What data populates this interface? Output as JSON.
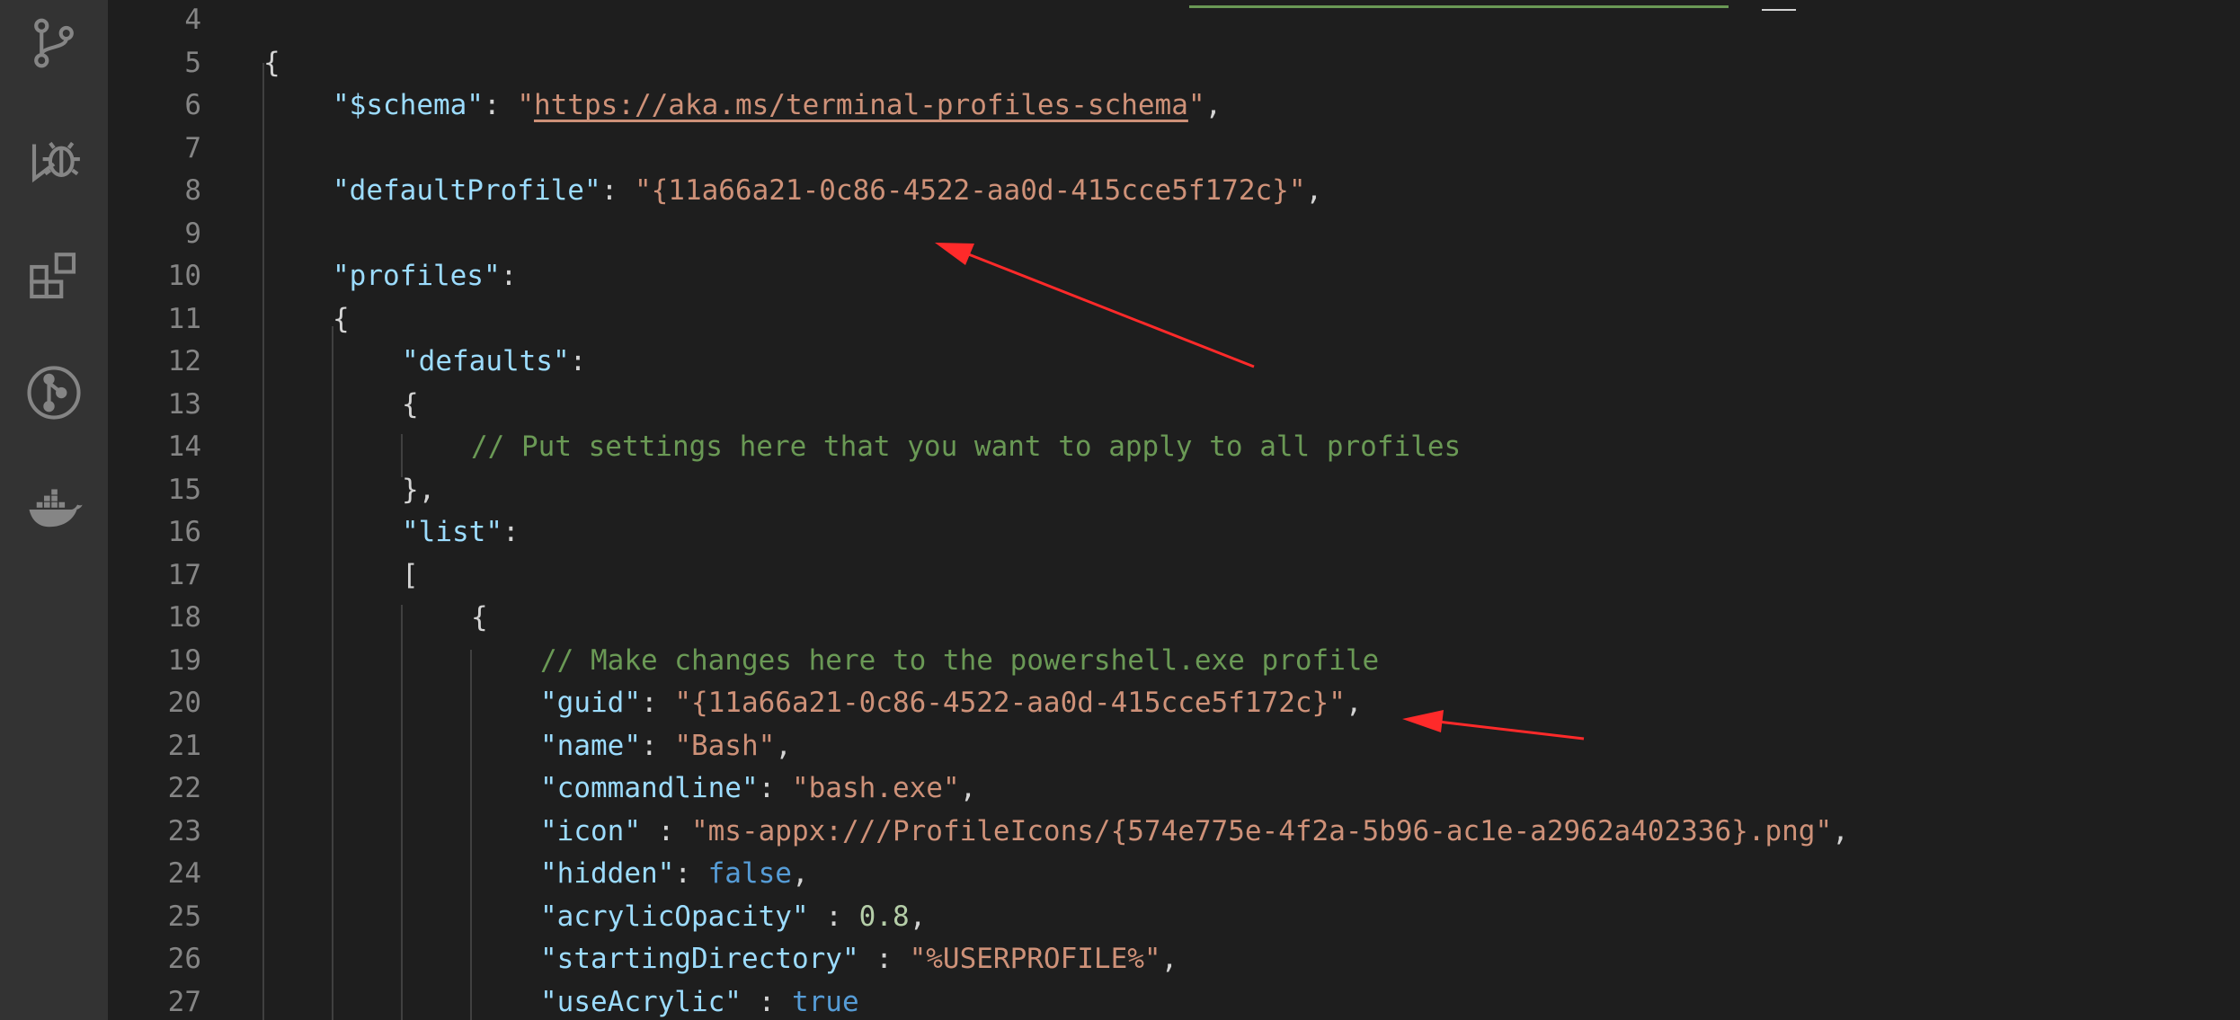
{
  "activity_bar": {
    "icons": [
      "source-control-icon",
      "run-debug-icon",
      "extensions-icon",
      "git-graph-icon",
      "docker-icon"
    ]
  },
  "editor": {
    "lines": [
      {
        "num": "4",
        "tokens": []
      },
      {
        "num": "5",
        "tokens": [
          {
            "t": "{",
            "c": "punc"
          }
        ]
      },
      {
        "num": "6",
        "tokens": [
          {
            "t": "\"$schema\"",
            "c": "key"
          },
          {
            "t": ": ",
            "c": "punc"
          },
          {
            "t": "\"",
            "c": "str"
          },
          {
            "t": "https://aka.ms/terminal-profiles-schema",
            "c": "link"
          },
          {
            "t": "\"",
            "c": "str"
          },
          {
            "t": ",",
            "c": "punc"
          }
        ]
      },
      {
        "num": "7",
        "tokens": []
      },
      {
        "num": "8",
        "tokens": [
          {
            "t": "\"defaultProfile\"",
            "c": "key"
          },
          {
            "t": ": ",
            "c": "punc"
          },
          {
            "t": "\"{11a66a21-0c86-4522-aa0d-415cce5f172c}\"",
            "c": "str"
          },
          {
            "t": ",",
            "c": "punc"
          }
        ]
      },
      {
        "num": "9",
        "tokens": []
      },
      {
        "num": "10",
        "tokens": [
          {
            "t": "\"profiles\"",
            "c": "key"
          },
          {
            "t": ":",
            "c": "punc"
          }
        ]
      },
      {
        "num": "11",
        "tokens": [
          {
            "t": "{",
            "c": "punc"
          }
        ]
      },
      {
        "num": "12",
        "tokens": [
          {
            "t": "\"defaults\"",
            "c": "key"
          },
          {
            "t": ":",
            "c": "punc"
          }
        ]
      },
      {
        "num": "13",
        "tokens": [
          {
            "t": "{",
            "c": "punc"
          }
        ]
      },
      {
        "num": "14",
        "tokens": [
          {
            "t": "// Put settings here that you want to apply to all profiles",
            "c": "com"
          }
        ]
      },
      {
        "num": "15",
        "tokens": [
          {
            "t": "},",
            "c": "punc"
          }
        ]
      },
      {
        "num": "16",
        "tokens": [
          {
            "t": "\"list\"",
            "c": "key"
          },
          {
            "t": ":",
            "c": "punc"
          }
        ]
      },
      {
        "num": "17",
        "tokens": [
          {
            "t": "[",
            "c": "punc"
          }
        ]
      },
      {
        "num": "18",
        "tokens": [
          {
            "t": "{",
            "c": "punc"
          }
        ]
      },
      {
        "num": "19",
        "tokens": [
          {
            "t": "// Make changes here to the powershell.exe profile",
            "c": "com"
          }
        ]
      },
      {
        "num": "20",
        "tokens": [
          {
            "t": "\"guid\"",
            "c": "key"
          },
          {
            "t": ": ",
            "c": "punc"
          },
          {
            "t": "\"{11a66a21-0c86-4522-aa0d-415cce5f172c}\"",
            "c": "str"
          },
          {
            "t": ",",
            "c": "punc"
          }
        ]
      },
      {
        "num": "21",
        "tokens": [
          {
            "t": "\"name\"",
            "c": "key"
          },
          {
            "t": ": ",
            "c": "punc"
          },
          {
            "t": "\"Bash\"",
            "c": "str"
          },
          {
            "t": ",",
            "c": "punc"
          }
        ]
      },
      {
        "num": "22",
        "tokens": [
          {
            "t": "\"commandline\"",
            "c": "key"
          },
          {
            "t": ": ",
            "c": "punc"
          },
          {
            "t": "\"bash.exe\"",
            "c": "str"
          },
          {
            "t": ",",
            "c": "punc"
          }
        ]
      },
      {
        "num": "23",
        "tokens": [
          {
            "t": "\"icon\"",
            "c": "key"
          },
          {
            "t": " : ",
            "c": "punc"
          },
          {
            "t": "\"ms-appx:///ProfileIcons/{574e775e-4f2a-5b96-ac1e-a2962a402336}.png\"",
            "c": "str"
          },
          {
            "t": ",",
            "c": "punc"
          }
        ]
      },
      {
        "num": "24",
        "tokens": [
          {
            "t": "\"hidden\"",
            "c": "key"
          },
          {
            "t": ": ",
            "c": "punc"
          },
          {
            "t": "false",
            "c": "bool"
          },
          {
            "t": ",",
            "c": "punc"
          }
        ]
      },
      {
        "num": "25",
        "tokens": [
          {
            "t": "\"acrylicOpacity\"",
            "c": "key"
          },
          {
            "t": " : ",
            "c": "punc"
          },
          {
            "t": "0.8",
            "c": "num"
          },
          {
            "t": ",",
            "c": "punc"
          }
        ]
      },
      {
        "num": "26",
        "tokens": [
          {
            "t": "\"startingDirectory\"",
            "c": "key"
          },
          {
            "t": " : ",
            "c": "punc"
          },
          {
            "t": "\"%USERPROFILE%\"",
            "c": "str"
          },
          {
            "t": ",",
            "c": "punc"
          }
        ]
      },
      {
        "num": "27",
        "tokens": [
          {
            "t": "\"useAcrylic\"",
            "c": "key"
          },
          {
            "t": " : ",
            "c": "punc"
          },
          {
            "t": "true",
            "c": "bool"
          }
        ]
      }
    ]
  },
  "colors": {
    "editor_bg": "#1e1e1e",
    "activity_bar_bg": "#333333",
    "key": "#9cdcfe",
    "string": "#ce9178",
    "comment": "#6a9955",
    "number": "#b5cea8",
    "keyword": "#569cd6",
    "annotation_arrow": "#ff2a2a"
  }
}
